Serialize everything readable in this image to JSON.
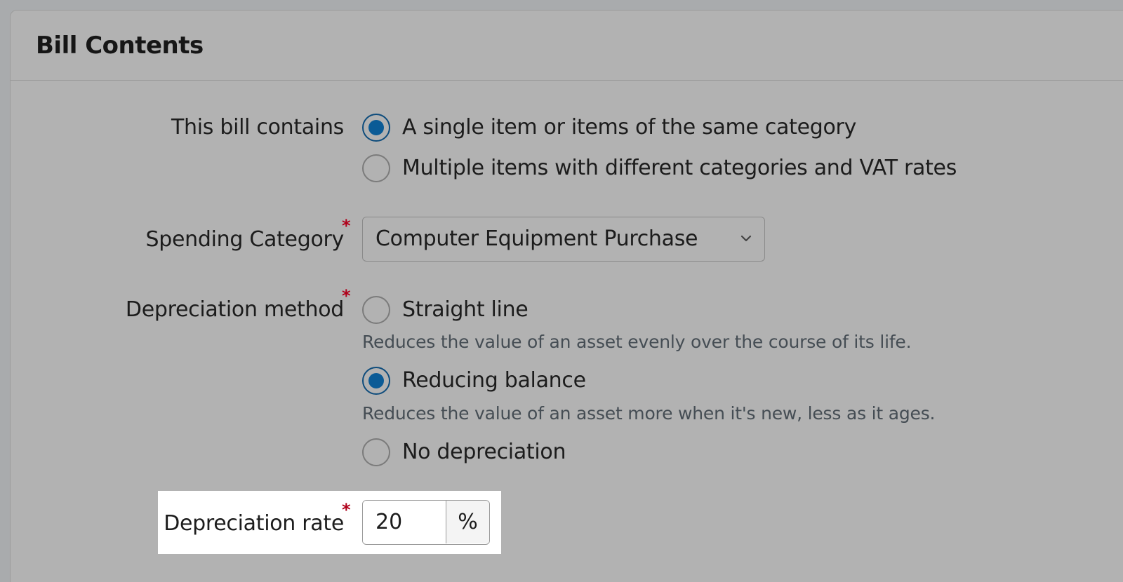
{
  "panel": {
    "title": "Bill Contents"
  },
  "bill_contains": {
    "label": "This bill contains",
    "options": [
      {
        "label": "A single item or items of the same category",
        "checked": true
      },
      {
        "label": "Multiple items with different categories and VAT rates",
        "checked": false
      }
    ]
  },
  "spending_category": {
    "label": "Spending Category",
    "required_mark": "*",
    "selected": "Computer Equipment Purchase",
    "icon": "chevron-down-icon"
  },
  "depreciation_method": {
    "label": "Depreciation method",
    "required_mark": "*",
    "options": [
      {
        "label": "Straight line",
        "hint": "Reduces the value of an asset evenly over the course of its life.",
        "checked": false
      },
      {
        "label": "Reducing balance",
        "hint": "Reduces the value of an asset more when it's new, less as it ages.",
        "checked": true
      },
      {
        "label": "No depreciation",
        "checked": false
      }
    ]
  },
  "depreciation_rate": {
    "label": "Depreciation rate",
    "required_mark": "*",
    "value": "20",
    "unit": "%"
  },
  "colors": {
    "radio_checked": "#0b5b96",
    "required": "#b0001a",
    "highlight": "#ffffff"
  }
}
